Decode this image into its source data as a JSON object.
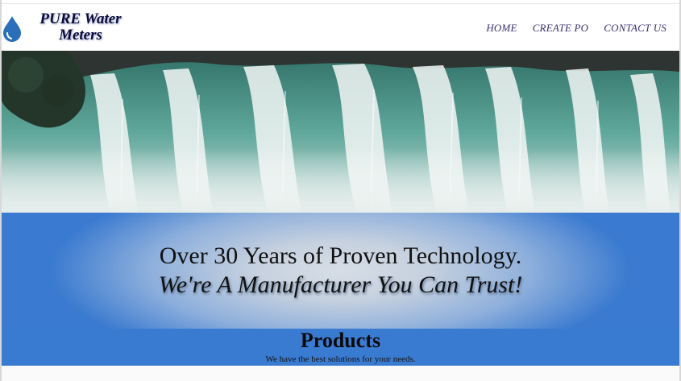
{
  "header": {
    "brand_line1": "PURE Water",
    "brand_line2": "Meters",
    "logo_icon": "water-drop-icon",
    "nav": [
      {
        "label": "HOME"
      },
      {
        "label": "CREATE PO"
      },
      {
        "label": "CONTACT US"
      }
    ]
  },
  "hero": {
    "image": "waterfall photo"
  },
  "banner": {
    "line1": "Over 30 Years of Proven Technology.",
    "line2": "We're A Manufacturer You Can Trust!"
  },
  "products": {
    "title": "Products",
    "subtitle": "We have the best solutions for your needs."
  },
  "colors": {
    "nav_text": "#3c2f6e",
    "brand_text": "#0b0b3a",
    "drop_blue": "#2a6fb8",
    "banner_blue": "#3a7ad0",
    "products_blue": "#3a7bd2"
  }
}
